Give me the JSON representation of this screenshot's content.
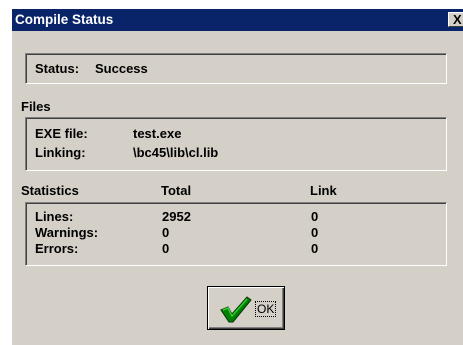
{
  "window": {
    "title": "Compile Status",
    "close_glyph": "X"
  },
  "status": {
    "label": "Status:",
    "value": "Success"
  },
  "files": {
    "heading": "Files",
    "exe_label": "EXE file:",
    "exe_value": "test.exe",
    "linking_label": "Linking:",
    "linking_value": "\\bc45\\lib\\cl.lib"
  },
  "statistics": {
    "heading": "Statistics",
    "col_total": "Total",
    "col_link": "Link",
    "rows": [
      {
        "label": "Lines:",
        "total": "2952",
        "link": "0"
      },
      {
        "label": "Warnings:",
        "total": "0",
        "link": "0"
      },
      {
        "label": "Errors:",
        "total": "0",
        "link": "0"
      }
    ]
  },
  "ok_button": {
    "label": "OK",
    "icon": "checkmark-icon",
    "icon_color": "#008000"
  }
}
